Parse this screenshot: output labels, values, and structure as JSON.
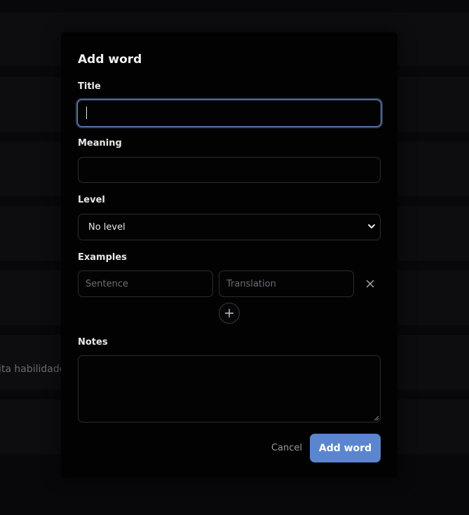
{
  "background": {
    "partial_text": "ita habilidade"
  },
  "modal": {
    "title": "Add word",
    "title_field": {
      "label": "Title",
      "value": ""
    },
    "meaning_field": {
      "label": "Meaning",
      "value": ""
    },
    "level_field": {
      "label": "Level",
      "selected": "No level"
    },
    "examples": {
      "label": "Examples",
      "sentence_placeholder": "Sentence",
      "translation_placeholder": "Translation",
      "remove_icon": "close-icon",
      "add_icon": "plus-icon"
    },
    "notes_field": {
      "label": "Notes",
      "value": ""
    },
    "actions": {
      "cancel_label": "Cancel",
      "submit_label": "Add word"
    }
  },
  "colors": {
    "accent": "#5b86cf",
    "focus_ring": "#6f8fc8",
    "modal_bg": "#020203",
    "border": "#2c2c31"
  }
}
